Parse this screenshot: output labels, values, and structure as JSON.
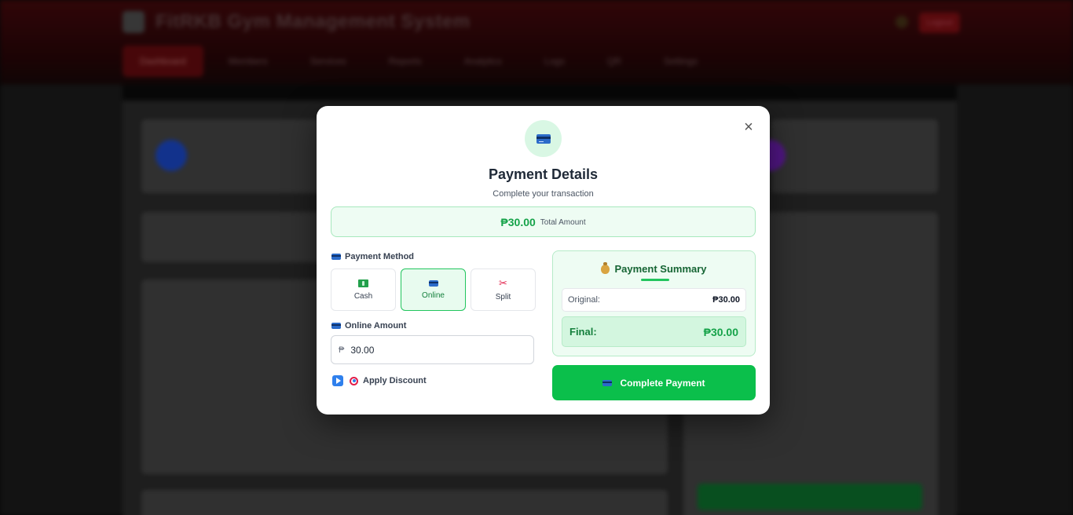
{
  "background": {
    "app_title": "FitRKB Gym Management System",
    "logout_label": "Logout",
    "nav_items": [
      "Dashboard",
      "Members",
      "Services",
      "Reports",
      "Analytics",
      "Logs",
      "QR",
      "Settings"
    ]
  },
  "modal": {
    "title": "Payment Details",
    "subtitle": "Complete your transaction",
    "total_amount": "₱30.00",
    "total_label": "Total Amount",
    "payment_method_label": "Payment Method",
    "methods": [
      {
        "label": "Cash",
        "icon": "cash-icon",
        "selected": false
      },
      {
        "label": "Online",
        "icon": "card-icon",
        "selected": true
      },
      {
        "label": "Split",
        "icon": "scissors-icon",
        "selected": false
      }
    ],
    "online_amount_label": "Online Amount",
    "currency_prefix": "₱",
    "online_amount_value": "30.00",
    "apply_discount_label": "Apply Discount",
    "summary": {
      "title": "Payment Summary",
      "original_label": "Original:",
      "original_value": "₱30.00",
      "final_label": "Final:",
      "final_value": "₱30.00"
    },
    "complete_button": "Complete Payment",
    "close_glyph": "×"
  },
  "colors": {
    "accent_green": "#16a34a",
    "button_green": "#0bbf4b",
    "header_red": "#6e0c10"
  }
}
